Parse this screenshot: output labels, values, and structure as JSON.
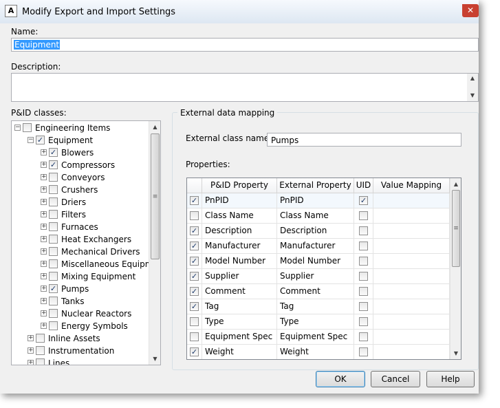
{
  "window": {
    "title": "Modify Export and Import Settings",
    "app_icon": "A",
    "close_glyph": "✕"
  },
  "name": {
    "label": "Name:",
    "value": "Equipment"
  },
  "description": {
    "label": "Description:",
    "value": ""
  },
  "tree": {
    "label": "P&ID classes:",
    "items": [
      {
        "label": "Engineering Items",
        "depth": 0,
        "expander": "−",
        "checked": false
      },
      {
        "label": "Equipment",
        "depth": 1,
        "expander": "−",
        "checked": true
      },
      {
        "label": "Blowers",
        "depth": 2,
        "expander": "+",
        "checked": true
      },
      {
        "label": "Compressors",
        "depth": 2,
        "expander": "+",
        "checked": true
      },
      {
        "label": "Conveyors",
        "depth": 2,
        "expander": "+",
        "checked": false
      },
      {
        "label": "Crushers",
        "depth": 2,
        "expander": "+",
        "checked": false
      },
      {
        "label": "Driers",
        "depth": 2,
        "expander": "+",
        "checked": false
      },
      {
        "label": "Filters",
        "depth": 2,
        "expander": "+",
        "checked": false
      },
      {
        "label": "Furnaces",
        "depth": 2,
        "expander": "+",
        "checked": false
      },
      {
        "label": "Heat Exchangers",
        "depth": 2,
        "expander": "+",
        "checked": false
      },
      {
        "label": "Mechanical Drivers",
        "depth": 2,
        "expander": "+",
        "checked": false
      },
      {
        "label": "Miscellaneous Equipment",
        "depth": 2,
        "expander": "+",
        "checked": false
      },
      {
        "label": "Mixing Equipment",
        "depth": 2,
        "expander": "+",
        "checked": false
      },
      {
        "label": "Pumps",
        "depth": 2,
        "expander": "+",
        "checked": true
      },
      {
        "label": "Tanks",
        "depth": 2,
        "expander": "+",
        "checked": false
      },
      {
        "label": "Nuclear Reactors",
        "depth": 2,
        "expander": "+",
        "checked": false
      },
      {
        "label": "Energy Symbols",
        "depth": 2,
        "expander": "+",
        "checked": false
      },
      {
        "label": "Inline Assets",
        "depth": 1,
        "expander": "+",
        "checked": false
      },
      {
        "label": "Instrumentation",
        "depth": 1,
        "expander": "+",
        "checked": false
      },
      {
        "label": "Lines",
        "depth": 1,
        "expander": "+",
        "checked": false
      }
    ]
  },
  "mapping": {
    "group_title": "External data mapping",
    "class_label": "External class name:",
    "class_value": "Pumps",
    "properties_label": "Properties:",
    "columns": [
      "P&ID Property",
      "External Property",
      "UID",
      "Value Mapping"
    ],
    "rows": [
      {
        "checked": true,
        "pid": "PnPID",
        "ext": "PnPID",
        "uid": true,
        "mapping": ""
      },
      {
        "checked": false,
        "pid": "Class Name",
        "ext": "Class Name",
        "uid": false,
        "mapping": ""
      },
      {
        "checked": true,
        "pid": "Description",
        "ext": "Description",
        "uid": false,
        "mapping": ""
      },
      {
        "checked": true,
        "pid": "Manufacturer",
        "ext": "Manufacturer",
        "uid": false,
        "mapping": ""
      },
      {
        "checked": true,
        "pid": "Model Number",
        "ext": "Model Number",
        "uid": false,
        "mapping": ""
      },
      {
        "checked": true,
        "pid": "Supplier",
        "ext": "Supplier",
        "uid": false,
        "mapping": ""
      },
      {
        "checked": true,
        "pid": "Comment",
        "ext": "Comment",
        "uid": false,
        "mapping": ""
      },
      {
        "checked": true,
        "pid": "Tag",
        "ext": "Tag",
        "uid": false,
        "mapping": ""
      },
      {
        "checked": false,
        "pid": "Type",
        "ext": "Type",
        "uid": false,
        "mapping": ""
      },
      {
        "checked": false,
        "pid": "Equipment Spec",
        "ext": "Equipment Spec",
        "uid": false,
        "mapping": ""
      },
      {
        "checked": true,
        "pid": "Weight",
        "ext": "Weight",
        "uid": false,
        "mapping": ""
      }
    ]
  },
  "buttons": {
    "ok": "OK",
    "cancel": "Cancel",
    "help": "Help"
  },
  "glyphs": {
    "check": "✓",
    "up": "▲",
    "down": "▼",
    "grip": "≡"
  },
  "colors": {
    "selection": "#3399ff",
    "row_highlight": "#f3f8fd",
    "close": "#c84031"
  }
}
